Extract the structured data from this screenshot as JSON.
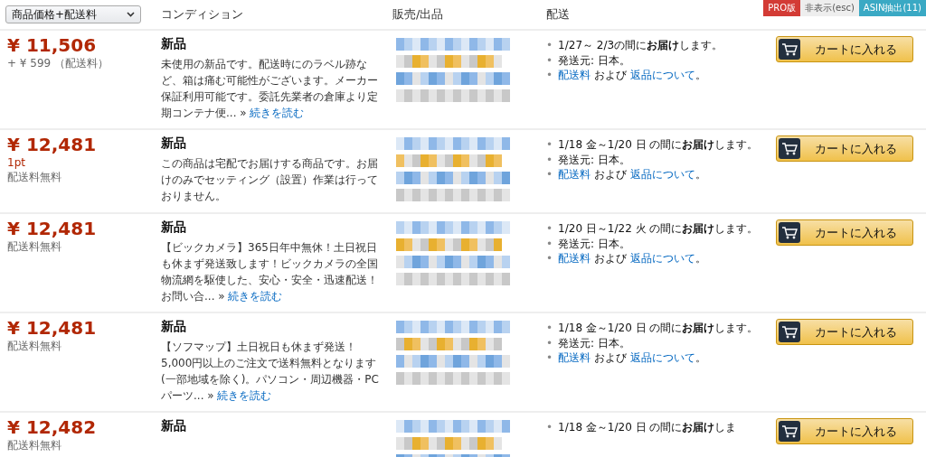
{
  "header": {
    "sort_select": "商品価格+配送料",
    "columns": [
      "コンディション",
      "販売/出品",
      "配送"
    ],
    "tools": [
      {
        "kind": "pro",
        "label": "PRO版"
      },
      {
        "kind": "hide",
        "label": "非表示(esc)"
      },
      {
        "kind": "asin",
        "label": "ASIN抽出(11)"
      }
    ]
  },
  "offers": [
    {
      "price": "¥ 11,506",
      "notes": [
        {
          "kind": "shipping",
          "text": "+ ¥ 599 （配送料）"
        }
      ],
      "condition": "新品",
      "description": "未使用の新品です。配送時にのラベル跡など、箱は痛む可能性がございます。メーカー保証利用可能です。委託先業者の倉庫より定期コンテナ便... »",
      "read_more": "続きを読む",
      "delivery": {
        "bullet": "•",
        "lines": [
          "1/27～ 2/3の間に**お届け**します。",
          "発送元: 日本。"
        ],
        "shipping_link": "配送料",
        "and": "および",
        "returns_link": "返品について",
        "period": "。"
      },
      "cart": "カートに入れる"
    },
    {
      "price": "¥ 12,481",
      "notes": [
        {
          "kind": "points",
          "text": "1pt"
        },
        {
          "kind": "shipping",
          "text": "配送料無料"
        }
      ],
      "condition": "新品",
      "description": "この商品は宅配でお届けする商品です。お届けのみでセッティング（設置）作業は行っておりません。",
      "delivery": {
        "bullet": "•",
        "lines": [
          "1/18 金～1/20 日 の間に**お届け**します。",
          "発送元: 日本。"
        ],
        "shipping_link": "配送料",
        "and": "および",
        "returns_link": "返品について",
        "period": "。"
      },
      "cart": "カートに入れる"
    },
    {
      "price": "¥ 12,481",
      "notes": [
        {
          "kind": "shipping",
          "text": "配送料無料"
        }
      ],
      "condition": "新品",
      "description": "【ビックカメラ】365日年中無休！土日祝日も休まず発送致します！ビックカメラの全国物流網を駆使した、安心・安全・迅速配送！お問い合... »",
      "read_more": "続きを読む",
      "delivery": {
        "bullet": "•",
        "lines": [
          "1/20 日～1/22 火 の間に**お届け**します。",
          "発送元: 日本。"
        ],
        "shipping_link": "配送料",
        "and": "および",
        "returns_link": "返品について",
        "period": "。"
      },
      "cart": "カートに入れる"
    },
    {
      "price": "¥ 12,481",
      "notes": [
        {
          "kind": "shipping",
          "text": "配送料無料"
        }
      ],
      "condition": "新品",
      "description": "【ソフマップ】土日祝日も休まず発送！5,000円以上のご注文で送料無料となります(一部地域を除く)。パソコン・周辺機器・PCパーツ... »",
      "read_more": "続きを読む",
      "delivery": {
        "bullet": "•",
        "lines": [
          "1/18 金～1/20 日 の間に**お届け**します。",
          "発送元: 日本。"
        ],
        "shipping_link": "配送料",
        "and": "および",
        "returns_link": "返品について",
        "period": "。"
      },
      "cart": "カートに入れる"
    },
    {
      "price": "¥ 12,482",
      "notes": [
        {
          "kind": "shipping",
          "text": "配送料無料"
        }
      ],
      "condition": "新品",
      "delivery": {
        "bullet": "•",
        "lines": [
          "1/18 金～1/20 日 の間に**お届け**しま"
        ]
      },
      "cart": "カートに入れる"
    }
  ]
}
